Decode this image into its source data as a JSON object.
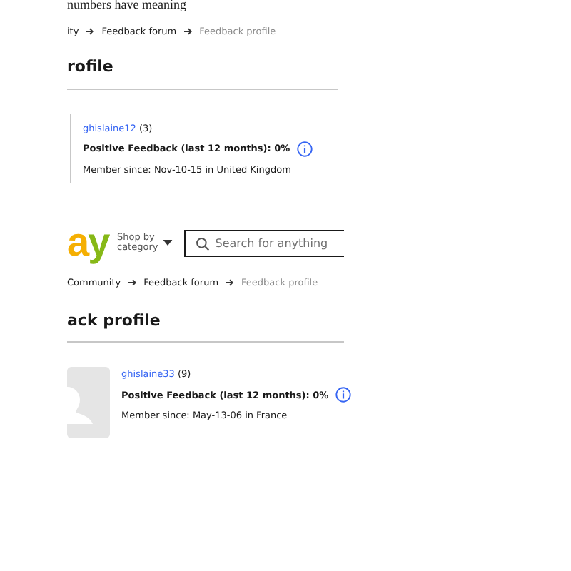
{
  "caption": "numbers have meaning",
  "first_capture": {
    "breadcrumbs": [
      {
        "label": "ity",
        "current": false
      },
      {
        "label": "Feedback forum",
        "current": false
      },
      {
        "label": "Feedback profile",
        "current": true
      }
    ],
    "heading": "rofile",
    "profile": {
      "username": "ghislaine12",
      "score": "(3)",
      "feedback": "Positive Feedback (last 12 months): 0%",
      "member_since": "Member since: Nov-10-15 in United Kingdom"
    }
  },
  "second_capture": {
    "logo_letters": [
      {
        "text": "a",
        "color": "#f5af02"
      },
      {
        "text": "y",
        "color": "#86b817"
      }
    ],
    "shop_by_category": [
      "Shop by",
      "category"
    ],
    "search": {
      "placeholder": "Search for anything"
    },
    "breadcrumbs": [
      {
        "label": "Community",
        "current": false
      },
      {
        "label": "Feedback forum",
        "current": false
      },
      {
        "label": "Feedback profile",
        "current": true
      }
    ],
    "heading": "ack profile",
    "profile": {
      "avatar": {
        "kind": "placeholder"
      },
      "username": "ghislaine33",
      "score": "(9)",
      "feedback": "Positive Feedback (last 12 months): 0%",
      "member_since": "Member since: May-13-06 in France"
    }
  }
}
